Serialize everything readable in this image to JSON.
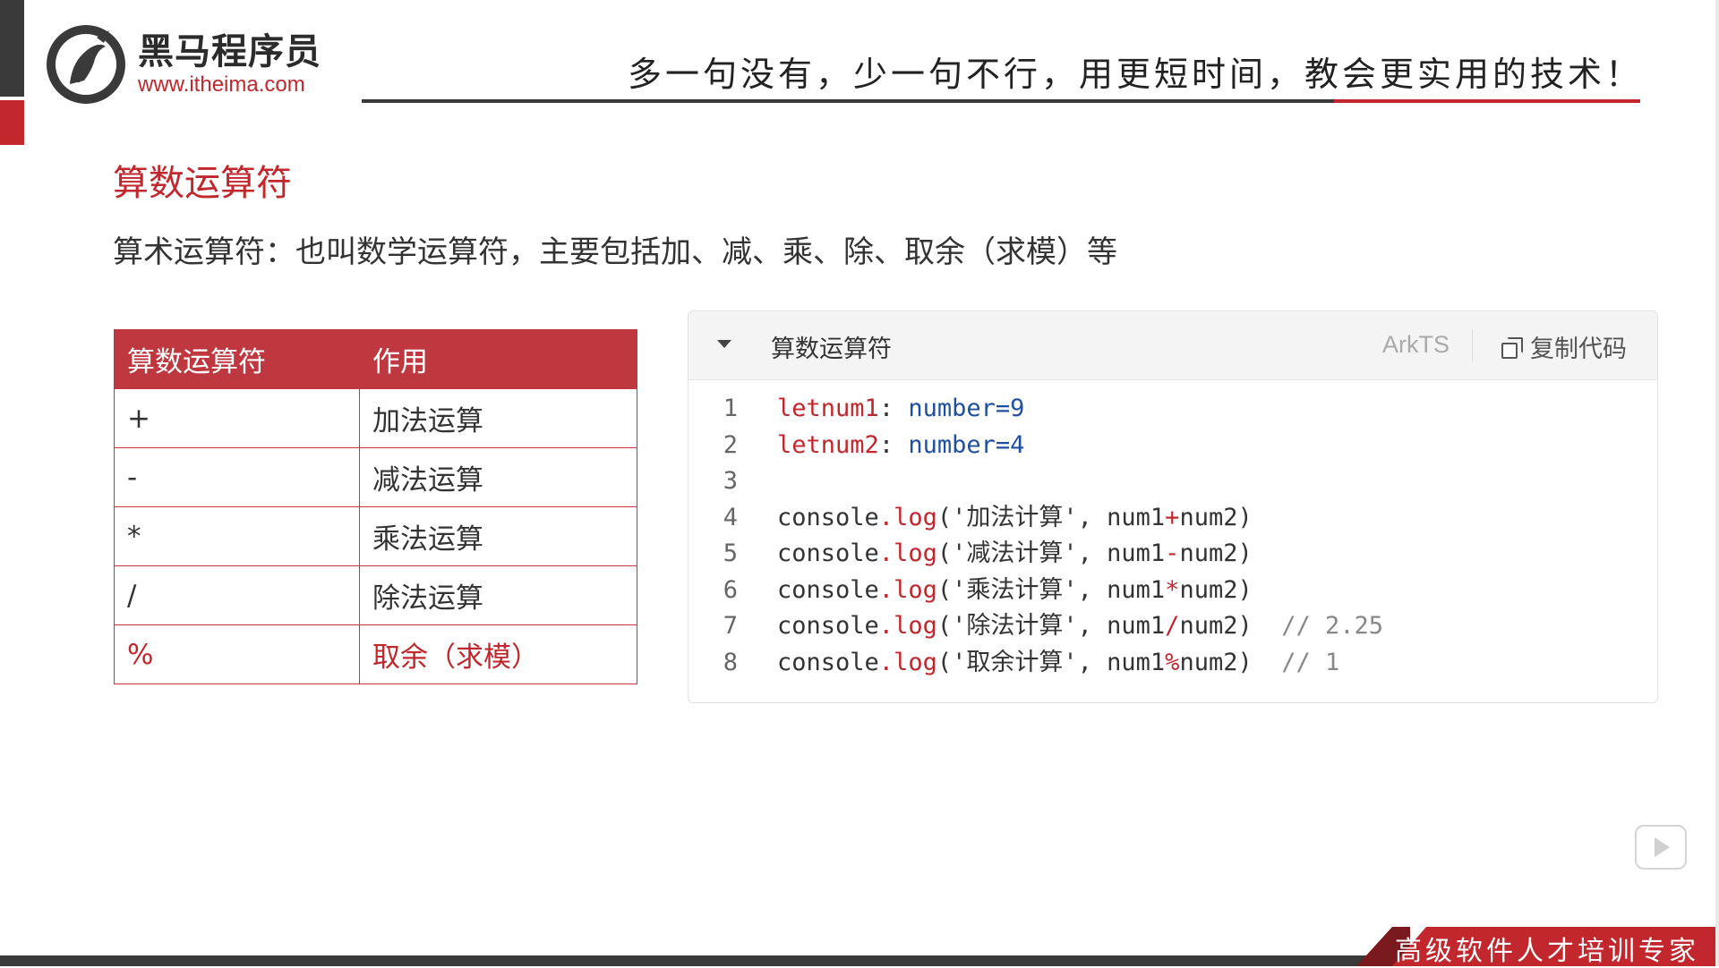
{
  "header": {
    "brand_cn": "黑马程序员",
    "brand_url": "www.itheima.com",
    "slogan": "多一句没有，少一句不行，用更短时间，教会更实用的技术！"
  },
  "section": {
    "title": "算数运算符",
    "description": "算术运算符：也叫数学运算符，主要包括加、减、乘、除、取余（求模）等"
  },
  "table": {
    "headers": [
      "算数运算符",
      "作用"
    ],
    "rows": [
      {
        "op": "+",
        "desc": "加法运算"
      },
      {
        "op": "-",
        "desc": "减法运算"
      },
      {
        "op": "*",
        "desc": "乘法运算"
      },
      {
        "op": "/",
        "desc": "除法运算"
      },
      {
        "op": "%",
        "desc": "取余（求模）"
      }
    ]
  },
  "code_block": {
    "title": "算数运算符",
    "language": "ArkTS",
    "copy_label": "复制代码",
    "line_numbers": [
      "1",
      "2",
      "3",
      "4",
      "5",
      "6",
      "7",
      "8"
    ],
    "lines": {
      "l1": {
        "kw": "let",
        "name": "num1",
        "type": "number",
        "value": "9"
      },
      "l2": {
        "kw": "let",
        "name": "num2",
        "type": "number",
        "value": "4"
      },
      "l4": {
        "label": "'加法计算'",
        "op": "+"
      },
      "l5": {
        "label": "'减法计算'",
        "op": "-"
      },
      "l6": {
        "label": "'乘法计算'",
        "op": "*"
      },
      "l7": {
        "label": "'除法计算'",
        "op": "/",
        "comment": "// 2.25"
      },
      "l8": {
        "label": "'取余计算'",
        "op": "%",
        "comment": "// 1"
      }
    },
    "tokens": {
      "console": "console",
      "log": "log",
      "a": "num1",
      "b": "num2"
    }
  },
  "footer": {
    "tagline": "高级软件人才培训专家"
  },
  "colors": {
    "accent": "#c1272d",
    "table_header": "#c0383f",
    "type_blue": "#1f4fa0"
  }
}
